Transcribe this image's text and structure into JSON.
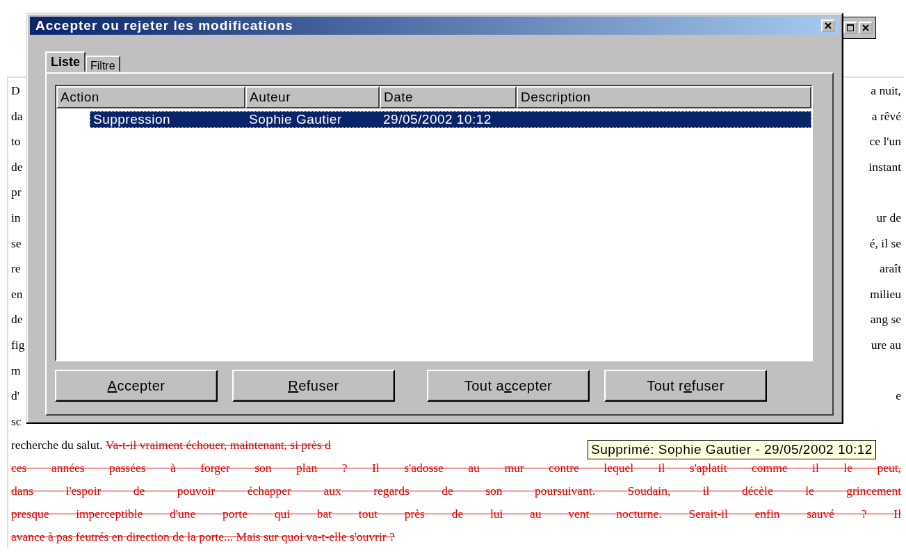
{
  "document": {
    "lines": [
      {
        "left": "D",
        "right": "a nuit,"
      },
      {
        "left": "da",
        "right": "a rêvé"
      },
      {
        "left": "to",
        "right": "ce l'un"
      },
      {
        "left": "de",
        "right": "instant"
      },
      {
        "left": "pr"
      },
      {
        "left": "in",
        "right": "ur de"
      },
      {
        "left": "se",
        "right": "é, il se"
      },
      {
        "left": "re",
        "right": "araît"
      },
      {
        "left": "en",
        "right": "milieu"
      },
      {
        "left": "de",
        "right": "ang se"
      },
      {
        "left": "fig",
        "right": "ure au"
      },
      {
        "left": "m"
      },
      {
        "left": "d'",
        "right": "e"
      },
      {
        "left": "sc"
      }
    ],
    "paragraph": [
      {
        "segments": [
          {
            "text": "recherche du salut. ",
            "deleted": false
          },
          {
            "text": "Va-t-il vraiment échouer, maintenant, si près d",
            "deleted": true
          }
        ]
      },
      {
        "segments": [
          {
            "text": "ces années passées à forger son plan ? Il s'adosse au mur contre lequel il s'aplatit comme il le peut,",
            "deleted": true
          }
        ]
      },
      {
        "segments": [
          {
            "text": "dans l'espoir de pouvoir échapper aux regards de son poursuivant. Soudain, il décèle le grincement",
            "deleted": true
          }
        ]
      },
      {
        "segments": [
          {
            "text": "presque imperceptible d'une porte qui bat tout près de lui au vent nocturne. Serait-il enfin sauvé ? Il",
            "deleted": true
          }
        ]
      },
      {
        "segments": [
          {
            "text": "avance à pas feutrés en direction de la porte... Mais sur quoi va-t-elle s'ouvrir ?",
            "deleted": true
          }
        ]
      }
    ],
    "tooltip": "Supprimé: Sophie Gautier - 29/05/2002 10:12"
  },
  "dialog": {
    "title": "Accepter ou rejeter les modifications",
    "tabs": [
      {
        "label": "Liste",
        "selected": true
      },
      {
        "label": "Filtre",
        "selected": false
      }
    ],
    "list": {
      "columns": [
        "Action",
        "Auteur",
        "Date",
        "Description"
      ],
      "rows": [
        {
          "cells": [
            "Suppression",
            "Sophie Gautier",
            "29/05/2002 10:12"
          ],
          "selected": true
        }
      ]
    },
    "buttons": [
      {
        "key": "A",
        "after": "ccepter"
      },
      {
        "key": "R",
        "after": "efuser"
      },
      {
        "before": "Tout a",
        "key": "c",
        "after": "cepter"
      },
      {
        "before": "Tout r",
        "key": "e",
        "after": "fuser"
      }
    ]
  }
}
